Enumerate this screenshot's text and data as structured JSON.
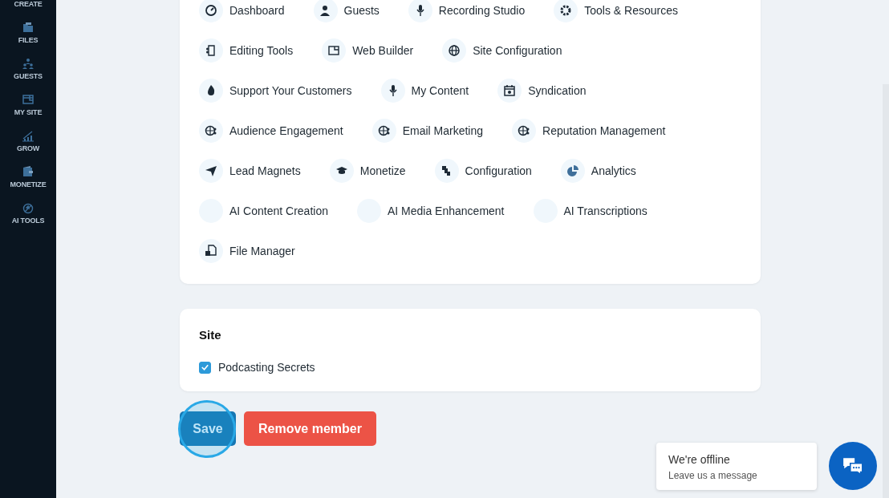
{
  "sidebar": {
    "items": [
      {
        "label": "CREATE"
      },
      {
        "label": "FILES"
      },
      {
        "label": "GUESTS"
      },
      {
        "label": "MY SITE"
      },
      {
        "label": "GROW"
      },
      {
        "label": "MONETIZE"
      },
      {
        "label": "AI TOOLS"
      }
    ]
  },
  "permissions": {
    "rows": [
      [
        {
          "label": "Dashboard"
        },
        {
          "label": "Guests"
        },
        {
          "label": "Recording Studio"
        },
        {
          "label": "Tools & Resources"
        }
      ],
      [
        {
          "label": "Editing Tools"
        },
        {
          "label": "Web Builder"
        },
        {
          "label": "Site Configuration"
        }
      ],
      [
        {
          "label": "Support Your Customers"
        },
        {
          "label": "My Content"
        },
        {
          "label": "Syndication"
        }
      ],
      [
        {
          "label": "Audience Engagement"
        },
        {
          "label": "Email Marketing"
        },
        {
          "label": "Reputation Management"
        }
      ],
      [
        {
          "label": "Lead Magnets"
        },
        {
          "label": "Monetize"
        },
        {
          "label": "Configuration"
        },
        {
          "label": "Analytics"
        }
      ],
      [
        {
          "label": "AI Content Creation"
        },
        {
          "label": "AI Media Enhancement"
        },
        {
          "label": "AI Transcriptions"
        }
      ],
      [
        {
          "label": "File Manager"
        }
      ]
    ]
  },
  "site": {
    "title": "Site",
    "options": [
      {
        "label": "Podcasting Secrets",
        "checked": true
      }
    ]
  },
  "buttons": [
    {
      "label": "Save",
      "kind": "save",
      "highlighted": true
    },
    {
      "label": "Remove member",
      "kind": "danger",
      "highlighted": false
    }
  ],
  "chat": {
    "title": "We're offline",
    "subtitle": "Leave us a message"
  }
}
